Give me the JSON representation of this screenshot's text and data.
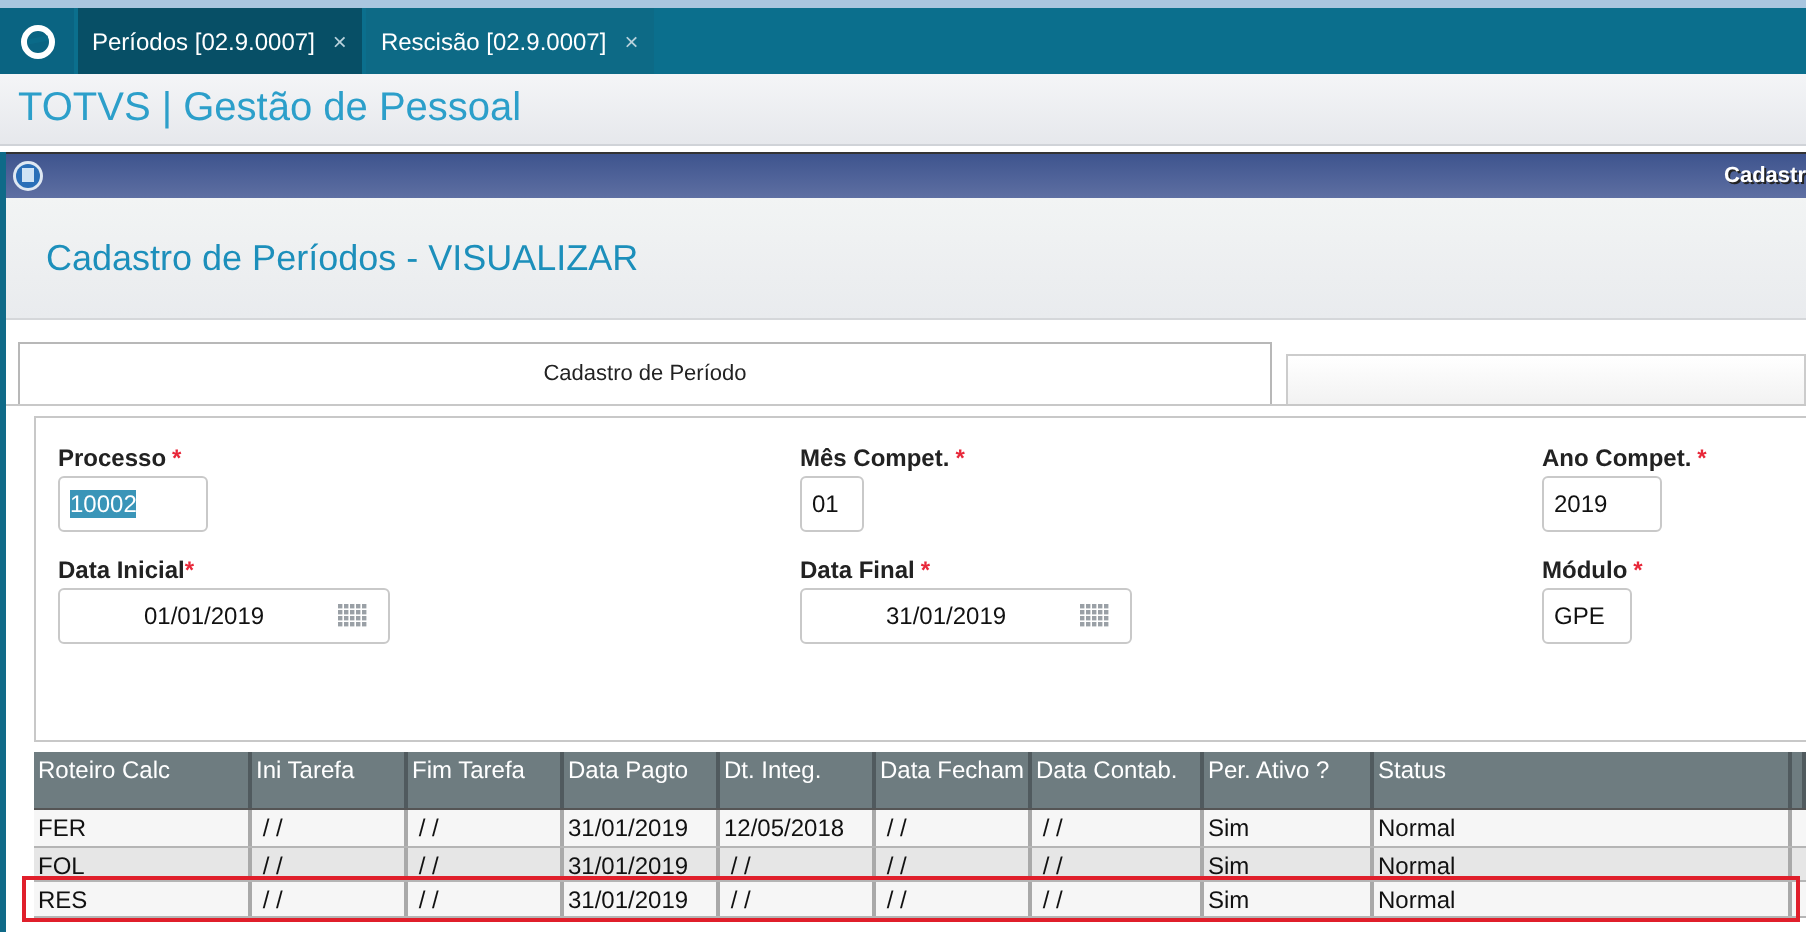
{
  "app_tabs": [
    {
      "label": "Períodos [02.9.0007]",
      "close": "×",
      "selected": true
    },
    {
      "label": "Rescisão [02.9.0007]",
      "close": "×",
      "selected": false
    }
  ],
  "app_title": "TOTVS | Gestão de Pessoal",
  "window": {
    "title": "Cadastr"
  },
  "page_title": "Cadastro de Períodos - VISUALIZAR",
  "form_tabs": [
    {
      "label": "Cadastro de Período",
      "selected": true
    },
    {
      "selected": false
    }
  ],
  "fields": [
    {
      "label": "Processo",
      "required_mark": "*",
      "value": "10002",
      "kind": "text",
      "highlighted": true
    },
    {
      "label": "Mês Compet.",
      "required_mark": "*",
      "value": "01",
      "kind": "text",
      "highlighted": false
    },
    {
      "label": "Ano Compet.",
      "required_mark": "*",
      "value": "2019",
      "kind": "text",
      "highlighted": false
    },
    {
      "label": "Data Inicial",
      "required_mark": "*",
      "value": "01/01/2019",
      "kind": "date",
      "highlighted": false
    },
    {
      "label": "Data Final",
      "required_mark": "*",
      "value": "31/01/2019",
      "kind": "date",
      "highlighted": false
    },
    {
      "label": "Módulo",
      "required_mark": "*",
      "value": "GPE",
      "kind": "text",
      "highlighted": false
    }
  ],
  "grid": {
    "columns": [
      "Roteiro Calc",
      "Ini Tarefa",
      "Fim Tarefa",
      "Data Pagto",
      "Dt. Integ.",
      "Data Fecham",
      "Data Contab.",
      "Per. Ativo ?",
      "Status"
    ],
    "rows": [
      {
        "cells": [
          "FER",
          " / /",
          " / /",
          "31/01/2019",
          "12/05/2018",
          " / /",
          " / /",
          "Sim",
          "Normal"
        ],
        "flagged": false
      },
      {
        "cells": [
          "FOL",
          " / /",
          " / /",
          "31/01/2019",
          " / /",
          " / /",
          " / /",
          "Sim",
          "Normal"
        ],
        "flagged": false
      },
      {
        "cells": [
          "RES",
          " / /",
          " / /",
          "31/01/2019",
          " / /",
          " / /",
          " / /",
          "Sim",
          "Normal"
        ],
        "flagged": true
      }
    ]
  }
}
